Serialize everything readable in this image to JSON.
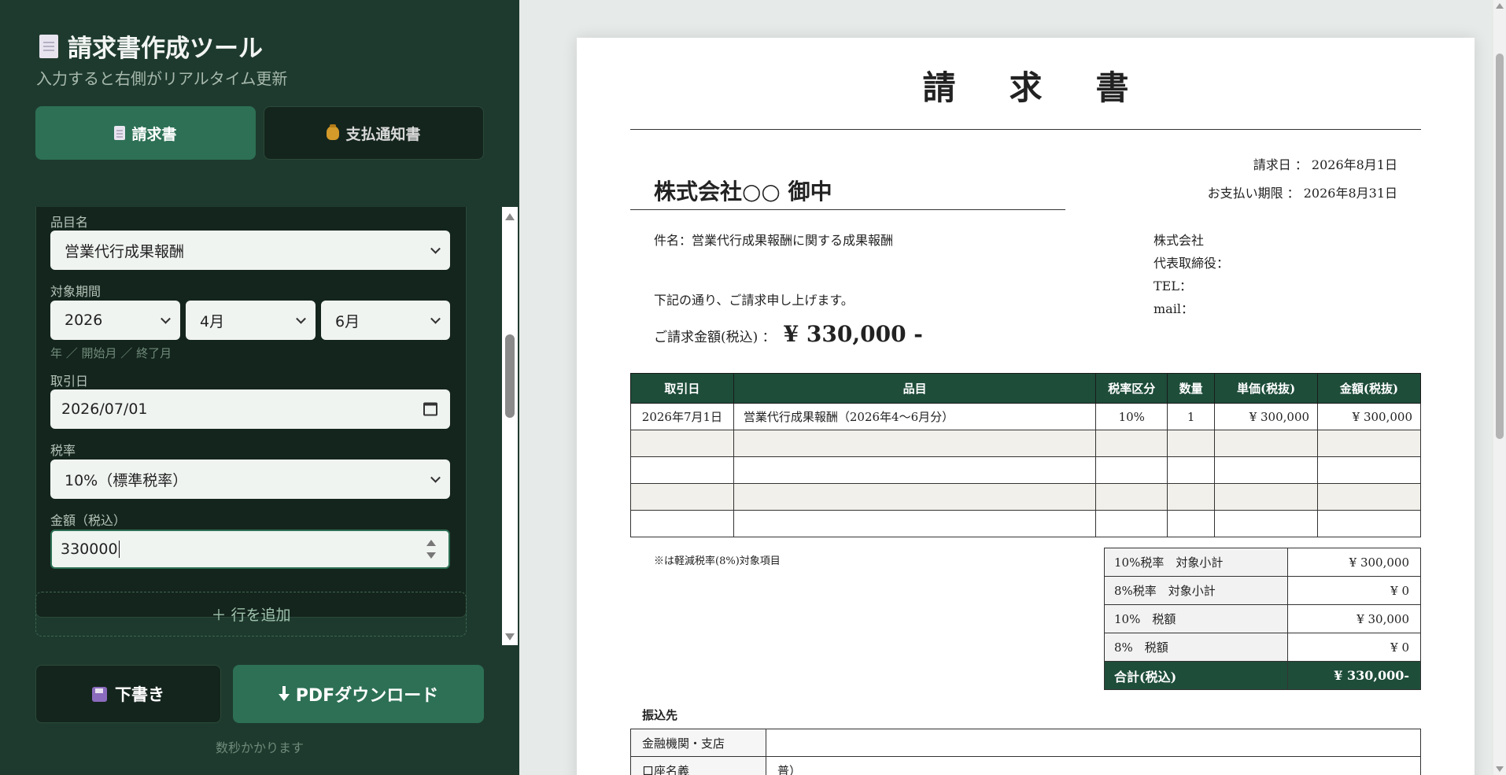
{
  "app": {
    "title": "請求書作成ツール",
    "subtitle": "入力すると右側がリアルタイム更新",
    "title_icon": "document-icon"
  },
  "tabs": [
    {
      "label": "請求書",
      "icon": "document-icon",
      "active": true
    },
    {
      "label": "支払通知書",
      "icon": "money-bag-icon",
      "active": false
    }
  ],
  "form": {
    "item_label": "品目名",
    "item_value": "営業代行成果報酬",
    "period_label": "対象期間",
    "period_year": "2026",
    "period_start": "4月",
    "period_end": "6月",
    "period_hint": "年 ／ 開始月 ／ 終了月",
    "date_label": "取引日",
    "date_value": "2026/07/01",
    "tax_label": "税率",
    "tax_value": "10%（標準税率）",
    "amount_label": "金額（税込）",
    "amount_value": "330000"
  },
  "add_row_label": "＋ 行を追加",
  "buttons": {
    "draft": "下書き",
    "pdf": "PDFダウンロード",
    "note": "数秒かかります"
  },
  "invoice": {
    "title": "請求書",
    "issue_date": "請求日 ： 2026年8月1日",
    "due_date": "お支払い期限 ： 2026年8月31日",
    "client": "株式会社○○ 御中",
    "subject": "件名：営業代行成果報酬に関する成果報酬",
    "company_lines": [
      "株式会社",
      "代表取締役：",
      "TEL：",
      "mail："
    ],
    "intro": "下記の通り、ご請求申し上げます。",
    "amount_key": "ご請求金額(税込) ：",
    "amount_value": "¥ 330,000 -",
    "table_headers": [
      "取引日",
      "品目",
      "税率区分",
      "数量",
      "単価(税抜)",
      "金額(税抜)"
    ],
    "rows": [
      [
        "2026年7月1日",
        "営業代行成果報酬（2026年4～6月分）",
        "10%",
        "1",
        "¥ 300,000",
        "¥ 300,000"
      ],
      [
        "",
        "",
        "",
        "",
        "",
        ""
      ],
      [
        "",
        "",
        "",
        "",
        "",
        ""
      ],
      [
        "",
        "",
        "",
        "",
        "",
        ""
      ],
      [
        "",
        "",
        "",
        "",
        "",
        ""
      ]
    ],
    "reduced_note": "※は軽減税率(8%)対象項目",
    "totals": [
      {
        "label": "10%税率　対象小計",
        "value": "¥ 300,000"
      },
      {
        "label": "8%税率　対象小計",
        "value": "¥ 0"
      },
      {
        "label": "10%　税額",
        "value": "¥ 30,000"
      },
      {
        "label": "8%　税額",
        "value": "¥ 0"
      }
    ],
    "total_label": "合計(税込)",
    "total_value": "¥ 330,000-",
    "bank_title": "振込先",
    "bank_rows": [
      {
        "label": "金融機関・支店",
        "value": ""
      },
      {
        "label": "口座名義",
        "value": "普）"
      }
    ]
  },
  "colors": {
    "panel_bg": "#1e3a2e",
    "accent": "#2d7055",
    "header_green": "#1e4d3a"
  }
}
